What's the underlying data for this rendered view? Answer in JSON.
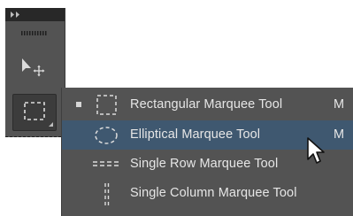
{
  "tools_panel": {
    "collapse_icon": "double-chevron-right-icon",
    "grip_icon": "grip-icon",
    "tools": [
      {
        "name": "Move Tool",
        "icon": "move-arrow-icon"
      },
      {
        "name": "Rectangular Marquee Tool",
        "icon": "rectangular-marquee-icon",
        "selected": true
      }
    ]
  },
  "flyout": {
    "items": [
      {
        "label": "Rectangular Marquee Tool",
        "shortcut": "M",
        "icon": "rectangular-marquee-icon",
        "checked": true,
        "highlighted": false
      },
      {
        "label": "Elliptical Marquee Tool",
        "shortcut": "M",
        "icon": "elliptical-marquee-icon",
        "checked": false,
        "highlighted": true
      },
      {
        "label": "Single Row Marquee Tool",
        "shortcut": "",
        "icon": "single-row-marquee-icon",
        "checked": false,
        "highlighted": false
      },
      {
        "label": "Single Column Marquee Tool",
        "shortcut": "",
        "icon": "single-column-marquee-icon",
        "checked": false,
        "highlighted": false
      }
    ]
  },
  "colors": {
    "panel_bg": "#535353",
    "panel_header": "#282828",
    "highlight": "#3f5870",
    "text": "#e6e6e6"
  },
  "cursor": "arrow-cursor-icon"
}
